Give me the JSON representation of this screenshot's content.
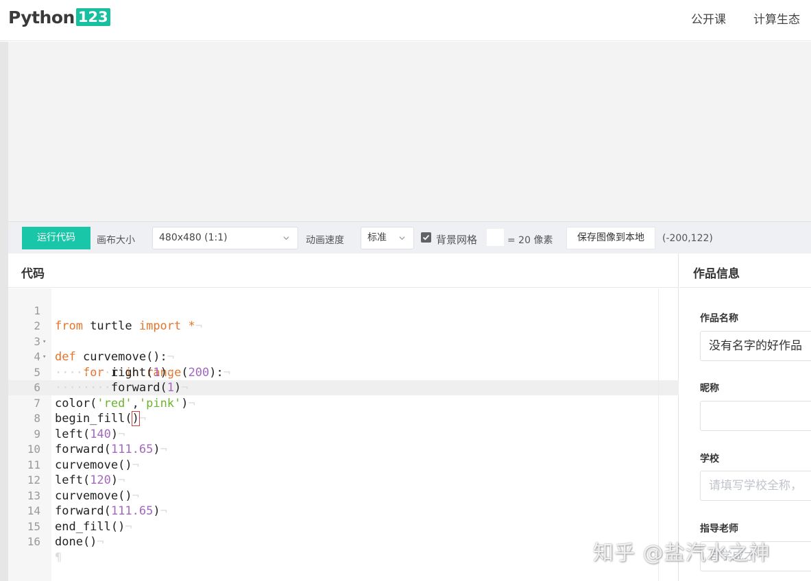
{
  "header": {
    "logo_text": "Python",
    "logo_num": "123",
    "nav": [
      "公开课",
      "计算生态"
    ],
    "accent_color": "#19c6a7"
  },
  "toolbar": {
    "run_label": "运行代码",
    "canvas_size_label": "画布大小",
    "canvas_size_value": "480x480 (1:1)",
    "speed_label": "动画速度",
    "speed_value": "标准",
    "grid_label": "背景网格",
    "grid_checked": true,
    "grid_value": "",
    "grid_suffix": "= 20 像素",
    "save_label": "保存图像到本地",
    "coordinates": "(-200,122)"
  },
  "code_panel": {
    "title": "代码",
    "active_line": 7,
    "lines": [
      {
        "n": "1",
        "text": "from turtle import *"
      },
      {
        "n": "2",
        "text": "def curvemove():"
      },
      {
        "n": "3",
        "text": "    for i in range(200):"
      },
      {
        "n": "4",
        "text": "        right(1)"
      },
      {
        "n": "5",
        "text": "        forward(1)"
      },
      {
        "n": "6",
        "text": "color('red','pink')"
      },
      {
        "n": "7",
        "text": "begin_fill()"
      },
      {
        "n": "8",
        "text": "left(140)"
      },
      {
        "n": "9",
        "text": "forward(111.65)"
      },
      {
        "n": "10",
        "text": "curvemove()"
      },
      {
        "n": "11",
        "text": "left(120)"
      },
      {
        "n": "12",
        "text": "curvemove()"
      },
      {
        "n": "13",
        "text": "forward(111.65)"
      },
      {
        "n": "14",
        "text": "end_fill()"
      },
      {
        "n": "15",
        "text": "done()"
      },
      {
        "n": "16",
        "text": ""
      }
    ]
  },
  "info_panel": {
    "title": "作品信息",
    "fields": [
      {
        "label": "作品名称",
        "value": "没有名字的好作品",
        "placeholder": ""
      },
      {
        "label": "昵称",
        "value": "",
        "placeholder": ""
      },
      {
        "label": "学校",
        "value": "",
        "placeholder": "请填写学校全称，"
      },
      {
        "label": "指导老师",
        "value": "",
        "placeholder": "自学成才"
      }
    ]
  },
  "watermark": "知乎 @盐汽水之神"
}
